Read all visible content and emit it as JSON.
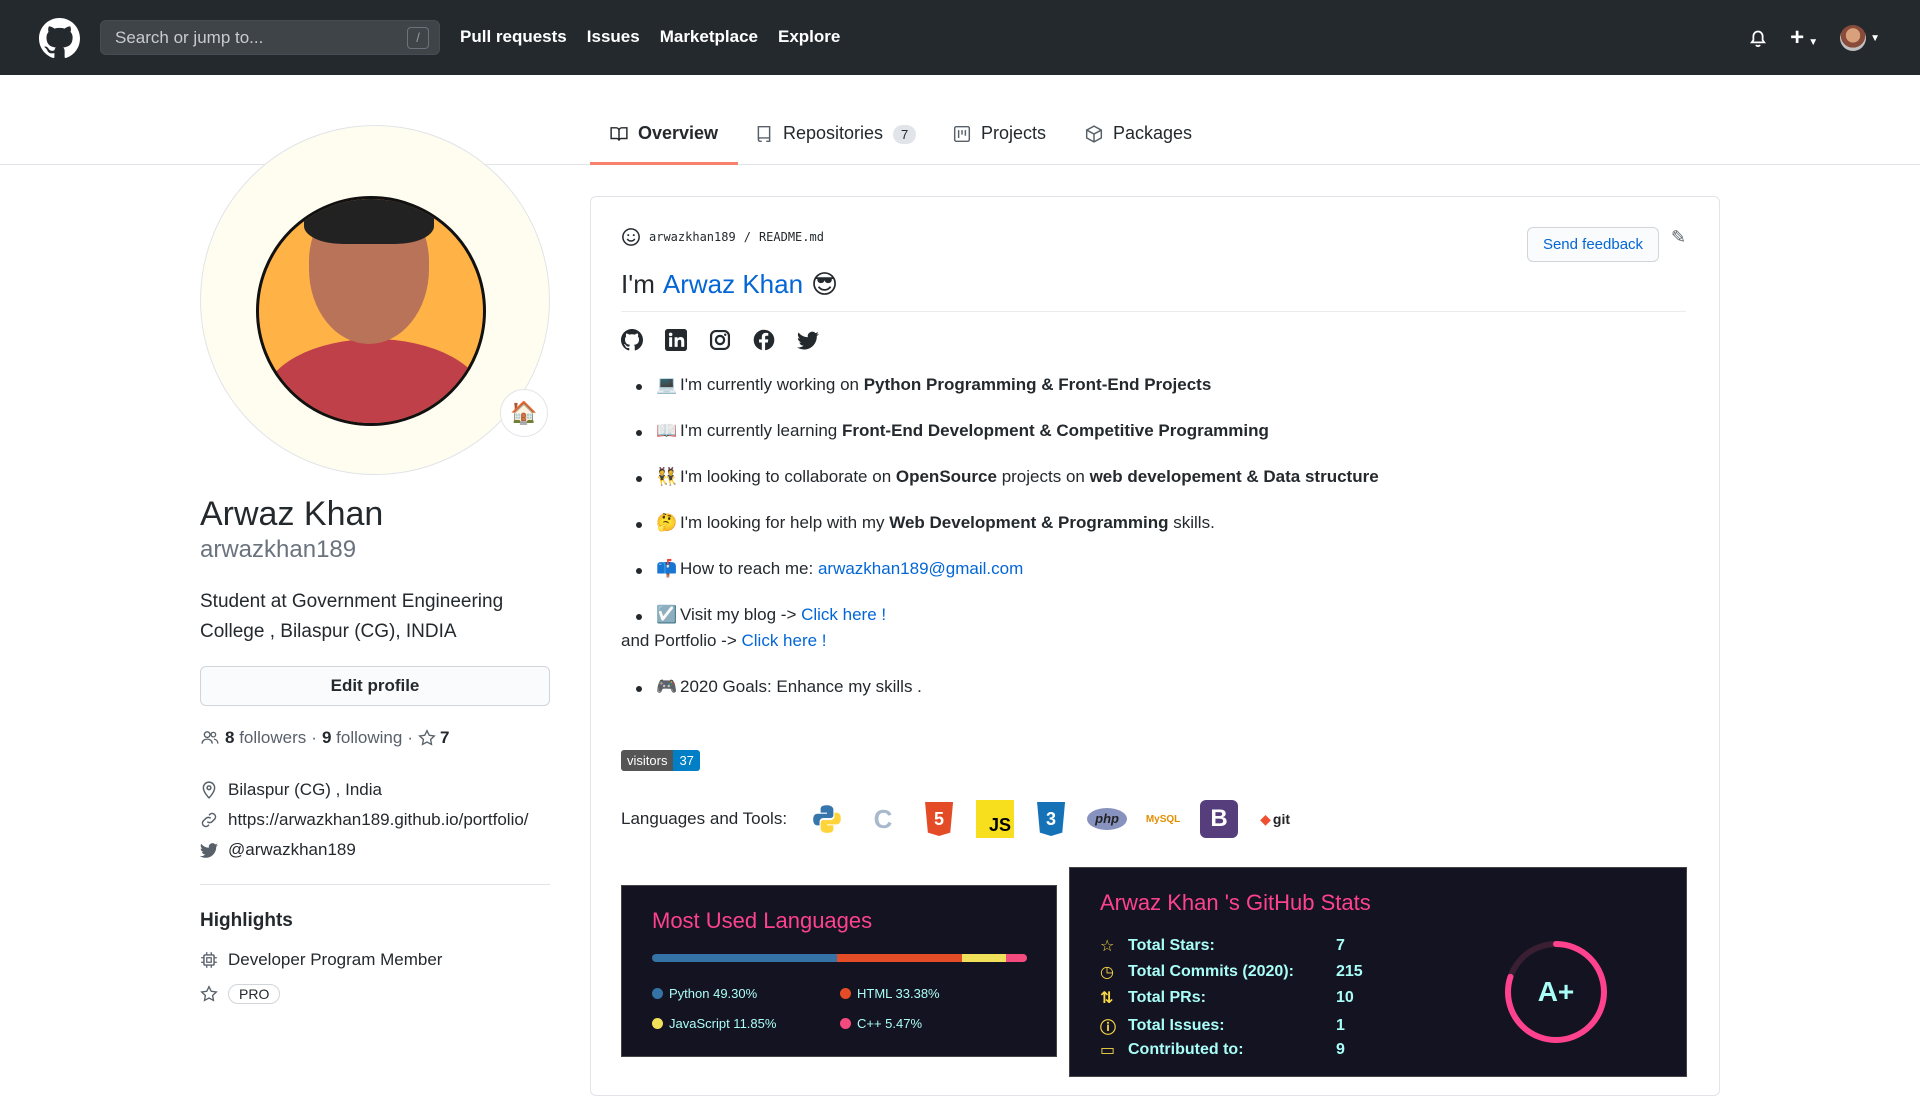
{
  "topbar": {
    "search_placeholder": "Search or jump to...",
    "search_shortcut": "/",
    "nav": [
      "Pull requests",
      "Issues",
      "Marketplace",
      "Explore"
    ],
    "plus": "+"
  },
  "tabs": [
    {
      "label": "Overview",
      "active": true
    },
    {
      "label": "Repositories",
      "count": "7"
    },
    {
      "label": "Projects"
    },
    {
      "label": "Packages"
    }
  ],
  "profile": {
    "fullname": "Arwaz Khan",
    "username": "arwazkhan189",
    "bio": "Student at Government Engineering College , Bilaspur (CG), INDIA",
    "edit_label": "Edit profile",
    "followers_count": "8",
    "followers_label": "followers",
    "following_count": "9",
    "following_label": "following",
    "stars_count": "7",
    "location": "Bilaspur (CG) , India",
    "website": "https://arwazkhan189.github.io/portfolio/",
    "twitter": "@arwazkhan189",
    "highlights_title": "Highlights",
    "highlight_member": "Developer Program Member",
    "highlight_pro": "PRO"
  },
  "readme": {
    "path_user": "arwazkhan189",
    "path_sep": "/",
    "path_file": "README.md",
    "feedback_label": "Send feedback",
    "title_prefix": "I'm",
    "title_name": "Arwaz Khan",
    "title_emoji": "😎",
    "bullets": [
      {
        "emoji": "💻",
        "text": "I'm currently working on ",
        "bold": "Python Programming & Front-End Projects"
      },
      {
        "emoji": "📖",
        "text": "I'm currently learning ",
        "bold": "Front-End Development & Competitive Programming"
      },
      {
        "emoji": "👯",
        "text": "I'm looking to collaborate on ",
        "bold": "OpenSource",
        "text2": " projects on ",
        "bold2": "web developement & Data structure"
      },
      {
        "emoji": "🤔",
        "text": "I'm looking for help with my ",
        "bold": "Web Development & Programming",
        "text2": " skills."
      },
      {
        "emoji": "📫",
        "text": "How to reach me: ",
        "link": "arwazkhan189@gmail.com"
      },
      {
        "emoji": "☑️",
        "text": "Visit my blog -> ",
        "link": "Click here !",
        "line2_text": "and Portfolio -> ",
        "line2_link": "Click here !"
      },
      {
        "emoji": "🎮",
        "text": "2020 Goals: Enhance my skills ."
      }
    ],
    "visitors_label": "visitors",
    "visitors_count": "37",
    "tools_label": "Languages and Tools:",
    "tools": [
      "python-icon",
      "c-icon",
      "html5-icon",
      "javascript-icon",
      "css3-icon",
      "php-icon",
      "mysql-icon",
      "bootstrap-icon",
      "git-icon"
    ],
    "tool_texts": {
      "c": "C",
      "html": "5",
      "js": "JS",
      "css": "3",
      "php": "php",
      "mysql": "MySQL",
      "bootstrap": "B",
      "git": "git"
    }
  },
  "languages_card": {
    "title": "Most Used Languages",
    "items": [
      {
        "name": "Python",
        "percent": 49.3,
        "label": "Python 49.30%",
        "color": "#3572A5"
      },
      {
        "name": "HTML",
        "percent": 33.38,
        "label": "HTML 33.38%",
        "color": "#e34c26"
      },
      {
        "name": "JavaScript",
        "percent": 11.85,
        "label": "JavaScript 11.85%",
        "color": "#f1e05a"
      },
      {
        "name": "C++",
        "percent": 5.47,
        "label": "C++ 5.47%",
        "color": "#f34b7d"
      }
    ]
  },
  "stats_card": {
    "title": "Arwaz Khan 's GitHub Stats",
    "rows": [
      {
        "label": "Total Stars:",
        "value": "7",
        "icon": "star-icon"
      },
      {
        "label": "Total Commits (2020):",
        "value": "215",
        "icon": "clock-icon"
      },
      {
        "label": "Total PRs:",
        "value": "10",
        "icon": "pr-icon"
      },
      {
        "label": "Total Issues:",
        "value": "1",
        "icon": "issue-icon"
      },
      {
        "label": "Contributed to:",
        "value": "9",
        "icon": "repo-icon"
      }
    ],
    "rank": "A+",
    "rank_progress": 0.8,
    "accent": "#fe428e",
    "text_color": "#a9fef7"
  }
}
